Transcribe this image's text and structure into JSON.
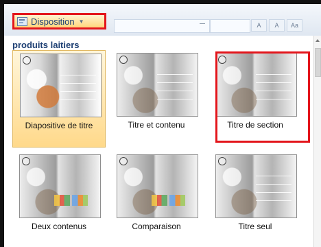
{
  "ribbon": {
    "layout_button_label": "Disposition",
    "dropdown_icon": "chevron-down-icon",
    "tool_labels": [
      "A",
      "A",
      "Aa"
    ]
  },
  "gallery": {
    "section_title": "produits laitiers",
    "items": [
      {
        "label": "Diapositive de titre",
        "thumbnail_icon": "slide-layout-thumbnail",
        "selected": true
      },
      {
        "label": "Titre et contenu",
        "thumbnail_icon": "slide-layout-thumbnail",
        "selected": false
      },
      {
        "label": "Titre de section",
        "thumbnail_icon": "slide-layout-thumbnail",
        "selected": false
      },
      {
        "label": "Deux contenus",
        "thumbnail_icon": "slide-layout-thumbnail",
        "selected": false
      },
      {
        "label": "Comparaison",
        "thumbnail_icon": "slide-layout-thumbnail",
        "selected": false
      },
      {
        "label": "Titre seul",
        "thumbnail_icon": "slide-layout-thumbnail",
        "selected": false
      }
    ]
  },
  "colors": {
    "highlight": "#e3151b",
    "selected_fill": "#ffd98a",
    "section_text": "#1d3f73"
  }
}
